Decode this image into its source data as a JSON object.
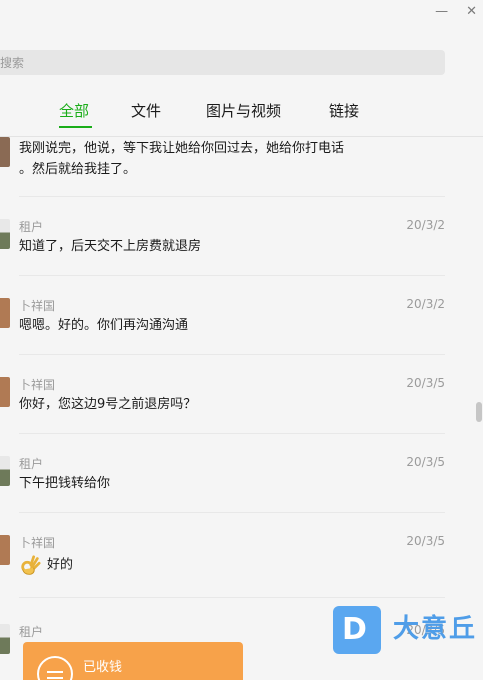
{
  "window": {
    "minimize": "—",
    "close": "✕"
  },
  "search": {
    "placeholder": "搜索"
  },
  "tabs": [
    {
      "label": "全部",
      "active": true
    },
    {
      "label": "文件",
      "active": false
    },
    {
      "label": "图片与视频",
      "active": false
    },
    {
      "label": "链接",
      "active": false
    }
  ],
  "messages": [
    {
      "sender": "",
      "time": "",
      "lines": [
        "我刚说完，他说，等下我让她给你回过去，她给你打电话",
        "。然后就给我挂了。"
      ]
    },
    {
      "sender": "租户",
      "time": "20/3/2",
      "lines": [
        "知道了，后天交不上房费就退房"
      ]
    },
    {
      "sender": "卜祥国",
      "time": "20/3/2",
      "lines": [
        "嗯嗯。好的。你们再沟通沟通"
      ]
    },
    {
      "sender": "卜祥国",
      "time": "20/3/5",
      "lines": [
        "你好，您这边9号之前退房吗？"
      ]
    },
    {
      "sender": "租户",
      "time": "20/3/5",
      "lines": [
        "下午把钱转给你"
      ]
    },
    {
      "sender": "卜祥国",
      "time": "20/3/5",
      "emoji": "ok-hand-emoji",
      "lines": [
        "好的"
      ]
    },
    {
      "sender": "租户",
      "time": "20/3/5",
      "lines": []
    }
  ],
  "transfer": {
    "label": "已收钱"
  },
  "watermark": {
    "text": "大意丘"
  },
  "colors": {
    "accent": "#1aad19",
    "transfer": "#f7a24a",
    "watermark": "#5aa7f0"
  }
}
